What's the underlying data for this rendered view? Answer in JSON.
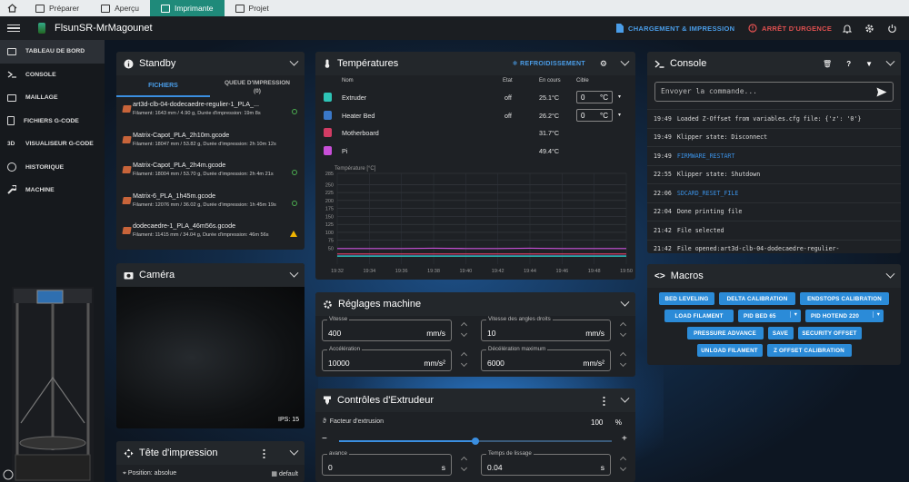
{
  "top_tabs": [
    {
      "label": "Préparer",
      "active": false
    },
    {
      "label": "Aperçu",
      "active": false
    },
    {
      "label": "Imprimante",
      "active": true
    },
    {
      "label": "Projet",
      "active": false
    }
  ],
  "header": {
    "printer_name": "FlsunSR-MrMagounet",
    "upload_print_label": "CHARGEMENT & IMPRESSION",
    "emergency_label": "ARRÊT D'URGENCE"
  },
  "sidebar": {
    "items": [
      {
        "label": "TABLEAU DE BORD",
        "icon": "dashboard-icon",
        "active": true
      },
      {
        "label": "CONSOLE",
        "icon": "console-icon",
        "active": false
      },
      {
        "label": "MAILLAGE",
        "icon": "grid-icon",
        "active": false
      },
      {
        "label": "FICHIERS G-CODE",
        "icon": "file-icon",
        "active": false
      },
      {
        "label": "VISUALISEUR G-CODE",
        "icon": "3d-icon",
        "active": false
      },
      {
        "label": "HISTORIQUE",
        "icon": "history-icon",
        "active": false
      },
      {
        "label": "MACHINE",
        "icon": "wrench-icon",
        "active": false
      }
    ]
  },
  "standby": {
    "title": "Standby",
    "tab_files": "FICHIERS",
    "tab_queue": "QUEUE D'IMPRESSION",
    "tab_queue_count": "(0)",
    "files": [
      {
        "name": "art3d-clb-04-dodecaedre-regulier-1_PLA_...",
        "meta": "Filament: 1643 mm / 4.90 g, Durée d'impression: 19m 8s",
        "status": "ok"
      },
      {
        "name": "Matrix-Capot_PLA_2h10m.gcode",
        "meta": "Filament: 18047 mm / 53.82 g, Durée d'impression: 2h 10m 12s",
        "status": "none"
      },
      {
        "name": "Matrix-Capot_PLA_2h4m.gcode",
        "meta": "Filament: 18004 mm / 53.70 g, Durée d'impression: 2h 4m 21s",
        "status": "ok"
      },
      {
        "name": "Matrix-6_PLA_1h45m.gcode",
        "meta": "Filament: 12076 mm / 36.02 g, Durée d'impression: 1h 45m 19s",
        "status": "ok"
      },
      {
        "name": "dodecaedre-1_PLA_46m56s.gcode",
        "meta": "Filament: 11415 mm / 34.04 g, Durée d'impression: 46m 56s",
        "status": "warn"
      }
    ]
  },
  "camera": {
    "title": "Caméra",
    "fps": "IPS: 15"
  },
  "toolhead": {
    "title": "Tête d'impression",
    "position": "Position: absolue",
    "mode": "default"
  },
  "temperatures": {
    "title": "Températures",
    "cooldown_label": "REFROIDISSEMENT",
    "col_name": "Nom",
    "col_state": "Etat",
    "col_current": "En cours",
    "col_target": "Cible",
    "rows": [
      {
        "name": "Extruder",
        "state": "off",
        "current": "25.1°C",
        "target": "0",
        "unit": "°C",
        "icon": "extruder-icon",
        "color": "#2ec4b6"
      },
      {
        "name": "Heater Bed",
        "state": "off",
        "current": "26.2°C",
        "target": "0",
        "unit": "°C",
        "icon": "bed-icon",
        "color": "#3a78c8"
      },
      {
        "name": "Motherboard",
        "state": "",
        "current": "31.7°C",
        "target": "",
        "unit": "",
        "icon": "thermometer-icon",
        "color": "#d23c64"
      },
      {
        "name": "Pi",
        "state": "",
        "current": "49.4°C",
        "target": "",
        "unit": "",
        "icon": "thermometer-icon",
        "color": "#c84fd8"
      }
    ]
  },
  "chart_data": {
    "type": "line",
    "ylabel": "Température [°C]",
    "ylim": [
      0,
      285
    ],
    "yticks": [
      50,
      75,
      100,
      125,
      150,
      175,
      200,
      225,
      250,
      285
    ],
    "x": [
      "19:32",
      "19:34",
      "19:36",
      "19:38",
      "19:40",
      "19:42",
      "19:44",
      "19:46",
      "19:48",
      "19:50"
    ],
    "grid": true,
    "series": [
      {
        "name": "Pi",
        "color": "#c84fd8",
        "values": [
          49,
          49,
          49,
          50,
          49,
          49,
          50,
          49,
          49,
          49
        ]
      },
      {
        "name": "Motherboard",
        "color": "#d23c64",
        "values": [
          32,
          32,
          32,
          32,
          32,
          32,
          32,
          32,
          32,
          32
        ]
      },
      {
        "name": "Heater Bed",
        "color": "#3a78c8",
        "values": [
          26,
          26,
          26,
          26,
          26,
          26,
          26,
          26,
          26,
          26
        ]
      },
      {
        "name": "Extruder",
        "color": "#2ec4b6",
        "values": [
          25,
          25,
          25,
          25,
          25,
          25,
          25,
          25,
          25,
          25
        ]
      }
    ]
  },
  "machine": {
    "title": "Réglages machine",
    "speed_label": "Vitesse",
    "speed_value": "400",
    "speed_unit": "mm/s",
    "sqv_label": "Vitesse des angles droits",
    "sqv_value": "10",
    "sqv_unit": "mm/s",
    "accel_label": "Accélération",
    "accel_value": "10000",
    "accel_unit": "mm/s²",
    "decel_label": "Décélération maximum",
    "decel_value": "6000",
    "decel_unit": "mm/s²"
  },
  "extruder": {
    "title": "Contrôles d'Extrudeur",
    "flow_label": "Facteur d'extrusion",
    "flow_value": "100",
    "flow_unit": "%",
    "flow_fraction": 0.5,
    "minus": "−",
    "plus": "+",
    "advance_label": "avance",
    "advance_value": "0",
    "advance_unit": "s",
    "smooth_label": "Temps de lissage",
    "smooth_value": "0.04",
    "smooth_unit": "s"
  },
  "console": {
    "title": "Console",
    "placeholder": "Envoyer la commande...",
    "lines": [
      {
        "time": "19:49",
        "text": "Loaded Z-Offset from variables.cfg file: {'z': '0'}",
        "cmd": false
      },
      {
        "time": "19:49",
        "text": "Klipper state: Disconnect",
        "cmd": false
      },
      {
        "time": "19:49",
        "text": "FIRMWARE_RESTART",
        "cmd": true
      },
      {
        "time": "22:55",
        "text": "Klipper state: Shutdown",
        "cmd": false
      },
      {
        "time": "22:06",
        "text": "SDCARD_RESET_FILE",
        "cmd": true
      },
      {
        "time": "22:04",
        "text": "Done printing file",
        "cmd": false
      },
      {
        "time": "21:42",
        "text": "File selected",
        "cmd": false
      },
      {
        "time": "21:42",
        "text": "File opened:art3d-clb-04-dodecaedre-regulier-",
        "cmd": false
      }
    ]
  },
  "macros": {
    "title": "Macros",
    "buttons": [
      [
        "BED LEVELING",
        "DELTA CALIBRATION",
        "ENDSTOPS CALIBRATION"
      ],
      [
        "LOAD FILAMENT",
        "PID BED 65",
        "PID HOTEND 220"
      ],
      [
        "PRESSURE ADVANCE",
        "SAVE",
        "SECURITY OFFSET"
      ],
      [
        "UNLOAD FILAMENT",
        "Z OFFSET CALIBRATION"
      ]
    ]
  },
  "colors": {
    "accent": "#2b8bd8",
    "emergency": "#e05050",
    "tab_active": "#1f8a7a"
  }
}
